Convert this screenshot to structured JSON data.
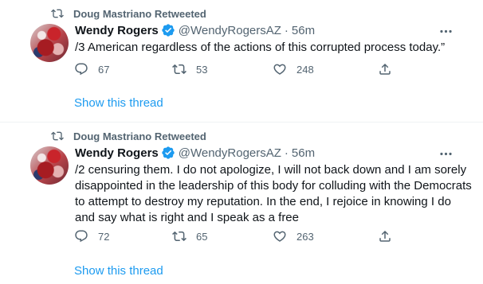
{
  "tweets": [
    {
      "retweeted_by": "Doug Mastriano Retweeted",
      "name": "Wendy Rogers",
      "handle": "@WendyRogersAZ",
      "separator": "·",
      "time": "56m",
      "text": "/3 American regardless of the actions of this corrupted process today.”",
      "replies": "67",
      "retweets": "53",
      "likes": "248",
      "show_thread": "Show this thread"
    },
    {
      "retweeted_by": "Doug Mastriano Retweeted",
      "name": "Wendy Rogers",
      "handle": "@WendyRogersAZ",
      "separator": "·",
      "time": "56m",
      "text": "/2 censuring them. I do not apologize, I will not back down and I am sorely disappointed in the leadership of this body for colluding with the Democrats to attempt to destroy my reputation. In the end, I rejoice in knowing I do and say what is right and I speak as a free",
      "replies": "72",
      "retweets": "65",
      "likes": "263",
      "show_thread": "Show this thread"
    }
  ],
  "icons": {
    "retweet": "retweet-icon",
    "verified": "verified-badge-icon",
    "more": "more-horizontal-icon",
    "reply": "reply-icon",
    "like": "heart-icon",
    "share": "share-icon"
  },
  "colors": {
    "accent": "#1d9bf0",
    "secondary_text": "#536471",
    "primary_text": "#0f1419",
    "divider": "#eff3f4"
  }
}
